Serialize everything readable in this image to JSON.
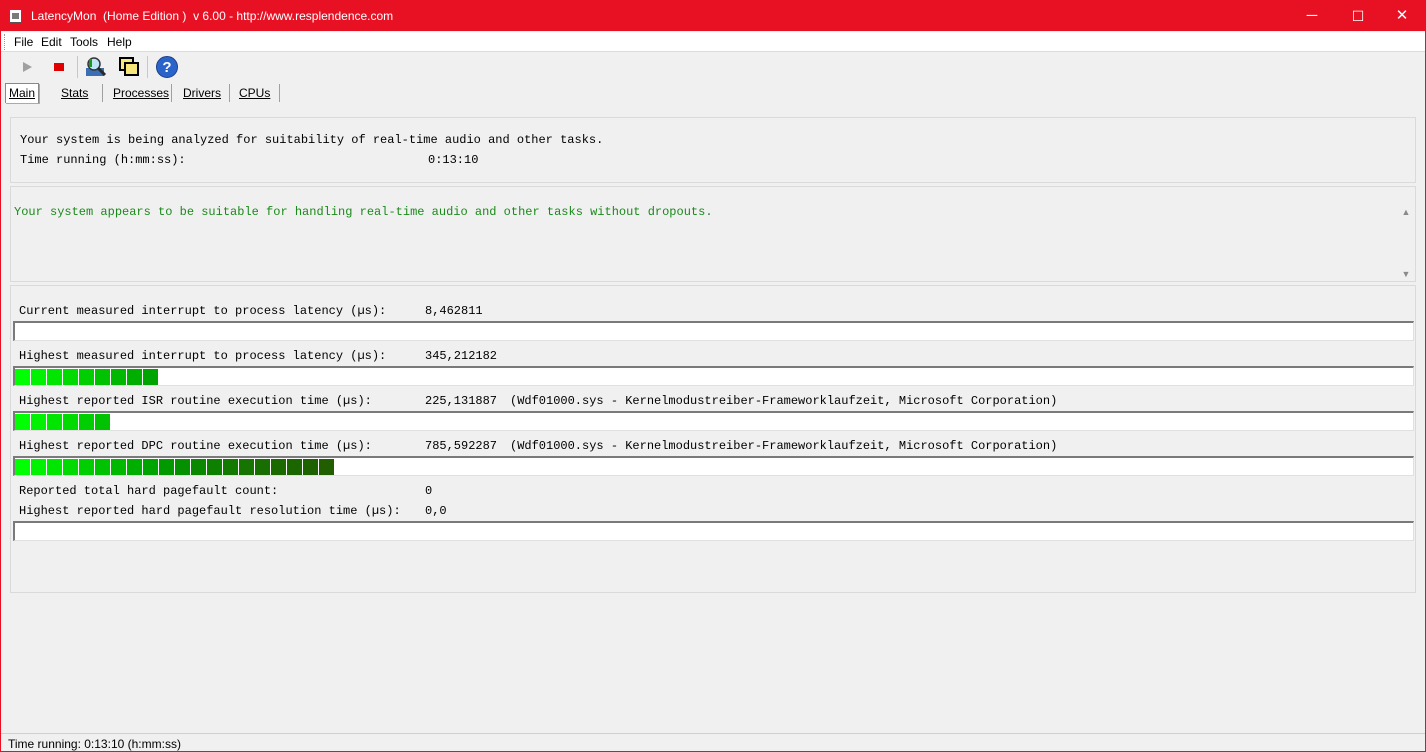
{
  "window": {
    "title": "LatencyMon  (Home Edition )  v 6.00 - http://www.resplendence.com",
    "minimize": "─",
    "maximize": "☐",
    "close": "✕"
  },
  "menu": [
    "File",
    "Edit",
    "Tools",
    "Help"
  ],
  "toolbar": {
    "buttons": [
      "play-icon",
      "stop-icon",
      "search-report-icon",
      "copy-windows-icon",
      "help-icon"
    ]
  },
  "tabs": [
    "Main",
    "Stats",
    "Processes",
    "Drivers",
    "CPUs"
  ],
  "active_tab": "Main",
  "status_panel": {
    "line1": "Your system is being analyzed for suitability of real-time audio and other tasks.",
    "time_label": "Time running (h:mm:ss):",
    "time_value": "0:13:10"
  },
  "verdict": {
    "text": "Your system appears to be suitable for handling real-time audio and other tasks without dropouts.",
    "color": "#1a8a1a"
  },
  "metrics": {
    "current_latency": {
      "label": "Current measured interrupt to process latency (µs):",
      "value": "8,462811",
      "bar_segments": 0
    },
    "highest_latency": {
      "label": "Highest measured interrupt to process latency (µs):",
      "value": "345,212182",
      "bar_segments": 9
    },
    "highest_isr": {
      "label": "Highest reported ISR routine execution time (µs):",
      "value": "225,131887",
      "detail": "(Wdf01000.sys - Kernelmodustreiber-Frameworklaufzeit, Microsoft Corporation)",
      "bar_segments": 6
    },
    "highest_dpc": {
      "label": "Highest reported DPC routine execution time (µs):",
      "value": "785,592287",
      "detail": "(Wdf01000.sys - Kernelmodustreiber-Frameworklaufzeit, Microsoft Corporation)",
      "bar_segments": 20
    },
    "pagefault_count": {
      "label": "Reported total hard pagefault count:",
      "value": "0"
    },
    "pagefault_time": {
      "label": "Highest reported hard pagefault resolution time (µs):",
      "value": "0,0",
      "bar_segments": 0
    }
  },
  "statusbar": {
    "text": "Time running: 0:13:10  (h:mm:ss)"
  }
}
